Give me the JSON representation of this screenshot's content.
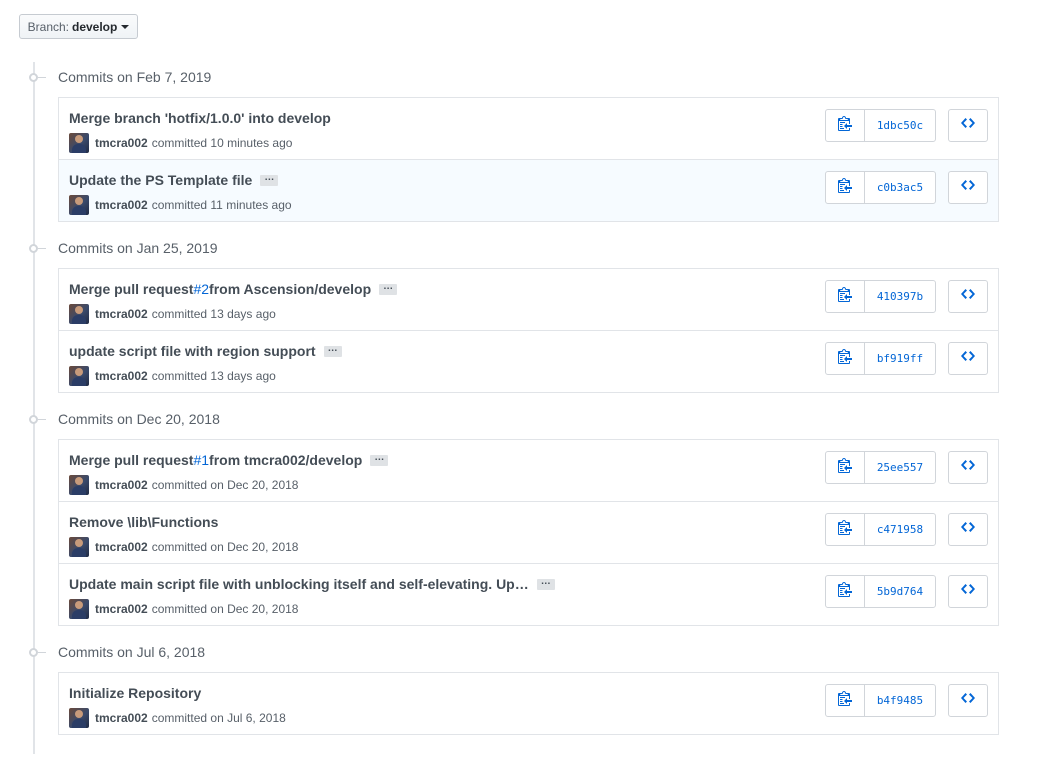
{
  "branch": {
    "label": "Branch:",
    "value": "develop"
  },
  "groups": [
    {
      "date": "Commits on Feb 7, 2019",
      "commits": [
        {
          "title": "Merge branch 'hotfix/1.0.0' into develop",
          "has_ellipsis": false,
          "author": "tmcra002",
          "time": "committed 10 minutes ago",
          "sha": "1dbc50c",
          "highlight": false
        },
        {
          "title": "Update the PS Template file",
          "has_ellipsis": true,
          "author": "tmcra002",
          "time": "committed 11 minutes ago",
          "sha": "c0b3ac5",
          "highlight": true
        }
      ]
    },
    {
      "date": "Commits on Jan 25, 2019",
      "commits": [
        {
          "title_pre": "Merge pull request ",
          "title_link": "#2",
          "title_post": " from Ascension/develop",
          "has_ellipsis": true,
          "author": "tmcra002",
          "time": "committed 13 days ago",
          "sha": "410397b",
          "highlight": false
        },
        {
          "title": "update script file with region support",
          "has_ellipsis": true,
          "author": "tmcra002",
          "time": "committed 13 days ago",
          "sha": "bf919ff",
          "highlight": false
        }
      ]
    },
    {
      "date": "Commits on Dec 20, 2018",
      "commits": [
        {
          "title_pre": "Merge pull request ",
          "title_link": "#1",
          "title_post": " from tmcra002/develop",
          "has_ellipsis": true,
          "author": "tmcra002",
          "time": "committed on Dec 20, 2018",
          "sha": "25ee557",
          "highlight": false
        },
        {
          "title": "Remove \\lib\\Functions",
          "has_ellipsis": false,
          "author": "tmcra002",
          "time": "committed on Dec 20, 2018",
          "sha": "c471958",
          "highlight": false
        },
        {
          "title": "Update main script file with unblocking itself and self-elevating. Up…",
          "has_ellipsis": true,
          "author": "tmcra002",
          "time": "committed on Dec 20, 2018",
          "sha": "5b9d764",
          "highlight": false
        }
      ]
    },
    {
      "date": "Commits on Jul 6, 2018",
      "commits": [
        {
          "title": "Initialize Repository",
          "has_ellipsis": false,
          "author": "tmcra002",
          "time": "committed on Jul 6, 2018",
          "sha": "b4f9485",
          "highlight": false
        }
      ]
    }
  ],
  "icons": {
    "copy": "clipboard-icon",
    "browse": "code-icon",
    "ellipsis": "ellipsis-icon"
  },
  "colors": {
    "link": "#0366d6",
    "highlight_row": "#f6fbff",
    "border": "#e1e4e8"
  }
}
